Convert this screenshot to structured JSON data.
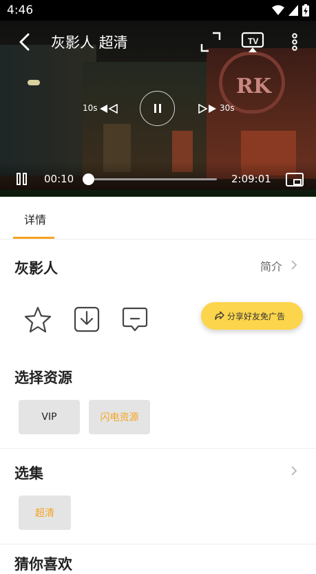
{
  "status_bar": {
    "time": "4:46"
  },
  "player": {
    "title": "灰影人 超清",
    "rewind_label": "10s",
    "forward_label": "30s",
    "current_time": "00:10",
    "total_time": "2:09:01",
    "progress_fraction": 0.0013,
    "sign_text": "RK"
  },
  "tabs": [
    {
      "label": "详情",
      "active": true
    }
  ],
  "details": {
    "movie_title": "灰影人",
    "intro_label": "简介",
    "share_label": "分享好友免广告"
  },
  "sources": {
    "title": "选择资源",
    "options": [
      {
        "label": "VIP",
        "active": false
      },
      {
        "label": "闪电资源",
        "active": true
      }
    ]
  },
  "episodes": {
    "title": "选集",
    "options": [
      {
        "label": "超清",
        "active": true
      }
    ]
  },
  "recommend": {
    "title": "猜你喜欢"
  },
  "colors": {
    "accent": "#f5a321",
    "share_button": "#fdd54c",
    "chip_bg": "#e4e4e4"
  }
}
